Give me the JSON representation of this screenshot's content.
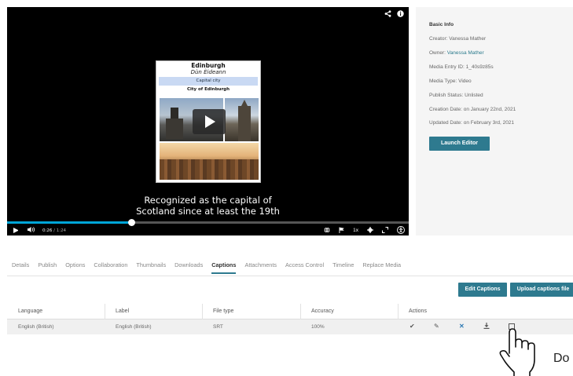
{
  "player": {
    "top_icons": [
      "share-icon",
      "info-icon"
    ],
    "infobox": {
      "title": "Edinburgh",
      "subtitle": "Dùn Èideann",
      "capital_label": "Capital city",
      "city_label": "City of Edinburgh"
    },
    "subtitle_line1": "Recognized as the capital of",
    "subtitle_line2": "Scotland since at least the 19th",
    "progress_fraction": 0.31,
    "current_time": "0:26",
    "duration": "/ 1:24",
    "speed": "1x",
    "colors": {
      "progress": "#00a5d8",
      "background": "#000000"
    }
  },
  "info": {
    "title": "Basic Info",
    "creator_label": "Creator:",
    "creator": "Vanessa Mather",
    "owner_label": "Owner:",
    "owner": "Vanessa Mather",
    "entry_id": "Media Entry ID: 1_40s9z85s",
    "media_type": "Media Type: Video",
    "publish_status": "Publish Status: Unlisted",
    "creation_date": "Creation Date: on January 22nd, 2021",
    "updated_date": "Updated Date: on February 3rd, 2021",
    "launch_editor": "Launch Editor"
  },
  "tabs": [
    {
      "label": "Details"
    },
    {
      "label": "Publish"
    },
    {
      "label": "Options"
    },
    {
      "label": "Collaboration"
    },
    {
      "label": "Thumbnails"
    },
    {
      "label": "Downloads"
    },
    {
      "label": "Captions"
    },
    {
      "label": "Attachments"
    },
    {
      "label": "Access Control"
    },
    {
      "label": "Timeline"
    },
    {
      "label": "Replace Media"
    }
  ],
  "active_tab": "Captions",
  "buttons": {
    "edit_captions": "Edit Captions",
    "upload_captions": "Upload captions file"
  },
  "table": {
    "headers": {
      "language": "Language",
      "label": "Label",
      "file_type": "File type",
      "accuracy": "Accuracy",
      "actions": "Actions"
    },
    "row": {
      "language": "English (British)",
      "label": "English (British)",
      "file_type": "SRT",
      "accuracy": "100%"
    },
    "row_actions": [
      "check-icon",
      "pencil-icon",
      "delete-icon",
      "download-icon",
      "preview-icon"
    ]
  },
  "callout": "Do",
  "accent_color": "#2e7a8f"
}
